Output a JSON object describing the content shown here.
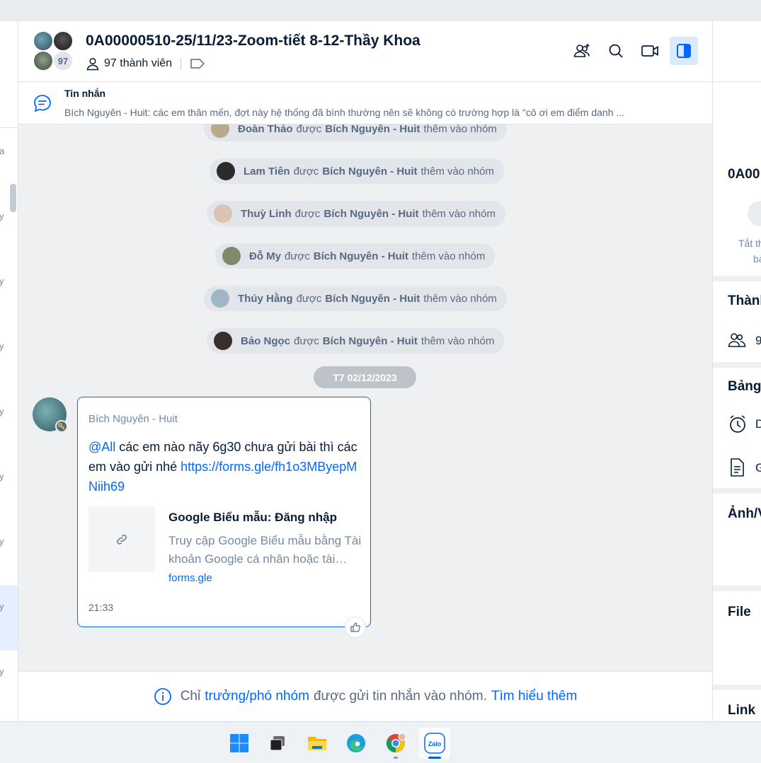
{
  "header": {
    "title": "0A00000510-25/11/23-Zoom-tiết 8-12-Thầy Khoa",
    "member_count_badge": "97",
    "members_label": "97 thành viên",
    "actions": [
      {
        "name": "add-member-icon"
      },
      {
        "name": "search-icon"
      },
      {
        "name": "video-call-icon"
      },
      {
        "name": "toggle-sidebar-icon",
        "active": true
      }
    ]
  },
  "pinned": {
    "label": "Tin nhắn",
    "text": "Bích Nguyên - Huit: các em thân mến, đợt này hệ thống đã bình thường nên sẽ không có trường hợp là \"cô ơi em điểm danh ..."
  },
  "system_messages": [
    {
      "name": "Đoàn Thảo",
      "verb": "được",
      "actor": "Bích Nguyên - Huit",
      "suffix": "thêm vào nhóm",
      "avatar_color": "#b9a98f"
    },
    {
      "name": "Lam Tiên",
      "verb": "được",
      "actor": "Bích Nguyên - Huit",
      "suffix": "thêm vào nhóm",
      "avatar_color": "#2b2b2b"
    },
    {
      "name": "Thuỳ Linh",
      "verb": "được",
      "actor": "Bích Nguyên - Huit",
      "suffix": "thêm vào nhóm",
      "avatar_color": "#d9c3b2"
    },
    {
      "name": "Đỗ My",
      "verb": "được",
      "actor": "Bích Nguyên - Huit",
      "suffix": "thêm vào nhóm",
      "avatar_color": "#7f8a6a"
    },
    {
      "name": "Thúy Hằng",
      "verb": "được",
      "actor": "Bích Nguyên - Huit",
      "suffix": "thêm vào nhóm",
      "avatar_color": "#9fb6c7"
    },
    {
      "name": "Bảo Ngọc",
      "verb": "được",
      "actor": "Bích Nguyên - Huit",
      "suffix": "thêm vào nhóm",
      "avatar_color": "#3a2e2a"
    }
  ],
  "date_separator": "T7 02/12/2023",
  "message": {
    "sender": "Bích Nguyên - Huit",
    "mention": "@All",
    "text": " các em nào nãy 6g30 chưa gửi bài thì các em vào gửi nhé ",
    "link": "https://forms.gle/fh1o3MByepMNiih69",
    "preview": {
      "title": "Google Biểu mẫu: Đăng nhập",
      "description": "Truy cập Google Biểu mẫu bằng Tài khoản Google cá nhân hoặc tài khoản Google Workspace",
      "domain": "forms.gle"
    },
    "time": "21:33"
  },
  "footer": {
    "prefix": "Chỉ",
    "role_link": "trưởng/phó nhóm",
    "middle": "được gửi tin nhắn vào nhóm.",
    "learn_more": "Tìm hiểu thêm"
  },
  "right_panel": {
    "group_name_fragment": "0A00",
    "mute_fragment_1": "Tắt th",
    "mute_fragment_2": "bá",
    "members_section": "Thành",
    "members_count_fragment": "9",
    "board_section": "Bảng",
    "reminder_fragment": "D",
    "notes_fragment": "G",
    "media_section": "Ảnh/V",
    "file_section": "File",
    "link_section": "Link"
  },
  "left_strip": {
    "fragments": [
      "a",
      "y",
      "y",
      "y",
      "y",
      "y",
      "y",
      "y",
      "y"
    ]
  },
  "taskbar": {
    "apps": [
      "windows-start",
      "task-view",
      "file-explorer",
      "microsoft-edge",
      "google-chrome",
      "zalo"
    ],
    "zalo_label": "Zalo"
  }
}
